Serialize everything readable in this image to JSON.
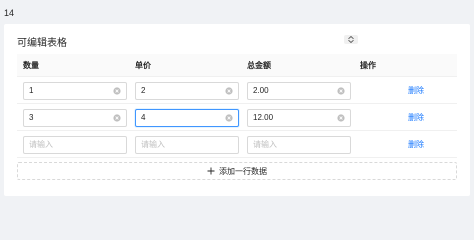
{
  "page": {
    "number": "14"
  },
  "card": {
    "title": "可编辑表格"
  },
  "table": {
    "columns": [
      {
        "label": "数量"
      },
      {
        "label": "单价"
      },
      {
        "label": "总金额"
      },
      {
        "label": "操作"
      }
    ],
    "rows": [
      {
        "quantity": "1",
        "price": "2",
        "total": "2.00",
        "action": "删除"
      },
      {
        "quantity": "3",
        "price": "4",
        "total": "12.00",
        "action": "删除"
      },
      {
        "quantity": "",
        "price": "",
        "total": "",
        "action": "删除"
      }
    ],
    "placeholder": "请输入",
    "focused_cell": "row-2-price"
  },
  "add_row": {
    "label": "添加一行数据"
  },
  "colors": {
    "link": "#1677ff",
    "focus_border": "#4096ff",
    "background": "#f0f2f5"
  }
}
